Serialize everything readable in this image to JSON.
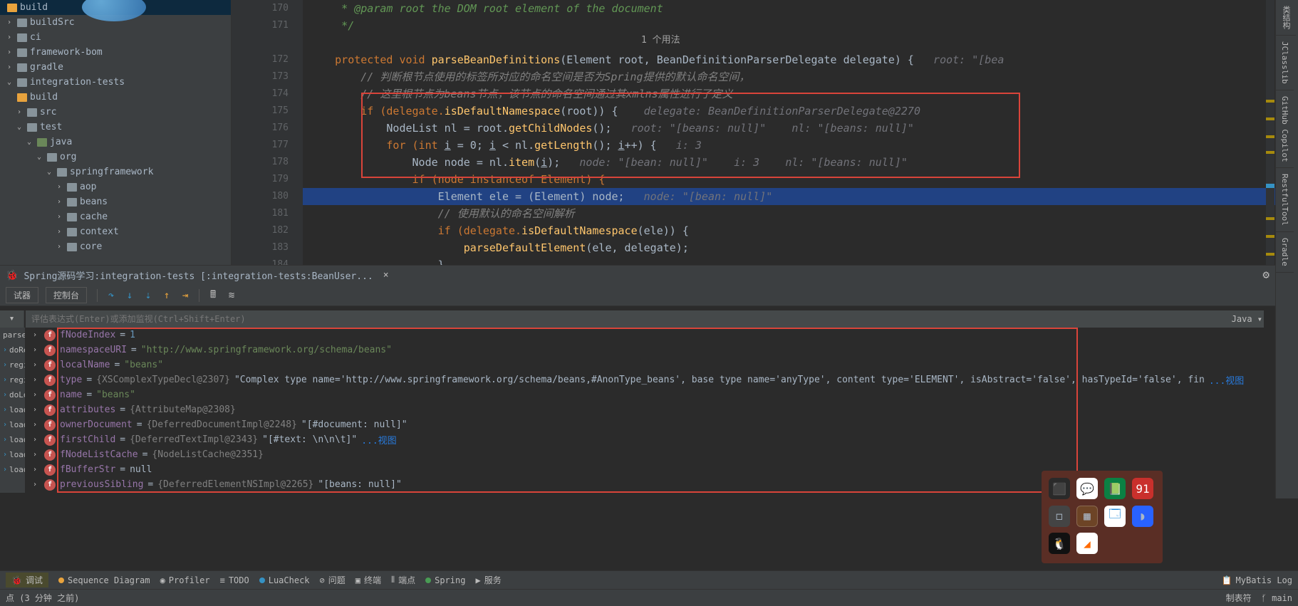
{
  "tree": {
    "items": [
      "build",
      "buildSrc",
      "ci",
      "framework-bom",
      "gradle",
      "integration-tests",
      "build",
      "src",
      "test",
      "java",
      "org",
      "springframework",
      "aop",
      "beans",
      "cache",
      "context",
      "core"
    ]
  },
  "gutter": {
    "lines": [
      "170",
      "171",
      "",
      "172",
      "173",
      "174",
      "175",
      "176",
      "177",
      "178",
      "179",
      "180",
      "181",
      "182",
      "183",
      "184"
    ]
  },
  "usage": "1 个用法",
  "code": {
    "l0": "      * @param root the DOM root element of the document",
    "l1": "      */",
    "l2a": "     protected void ",
    "l2b": "parseBeanDefinitions",
    "l2c": "(Element root, BeanDefinitionParserDelegate delegate) {   ",
    "l2hint": "root: \"[bea",
    "l3": "         // 判断根节点使用的标签所对应的命名空间是否为Spring提供的默认命名空间，",
    "l4": "         // 这里根节点为beans节点，该节点的命名空间通过其xmlns属性进行了定义",
    "l5a": "         if (delegate.",
    "l5b": "isDefaultNamespace",
    "l5c": "(root)) {    ",
    "l5hint": "delegate: BeanDefinitionParserDelegate@2270",
    "l6a": "             NodeList nl = root.",
    "l6b": "getChildNodes",
    "l6c": "();   ",
    "l6hint": "root: \"[beans: null]\"    nl: \"[beans: null]\"",
    "l7a": "             for (int ",
    "l7b": "i",
    "l7c": " = 0; ",
    "l7d": "i",
    "l7e": " < nl.",
    "l7f": "getLength",
    "l7g": "(); ",
    "l7h": "i",
    "l7i": "++) {   ",
    "l7hint": "i: 3",
    "l8a": "                 Node node = nl.",
    "l8b": "item",
    "l8c": "(",
    "l8d": "i",
    "l8e": ");   ",
    "l8hint": "node: \"[bean: null]\"    i: 3    nl: \"[beans: null]\"",
    "l9a": "                 if (node instanceof Element) {",
    "l10a": "                     Element ele = (Element) node;   ",
    "l10hint": "node: \"[bean: null]\"",
    "l11": "                     // 使用默认的命名空间解析",
    "l12a": "                     if (delegate.",
    "l12b": "isDefaultNamespace",
    "l12c": "(ele)) {",
    "l13a": "                         ",
    "l13b": "parseDefaultElement",
    "l13c": "(ele, delegate);",
    "l14": "                     }"
  },
  "dbg": {
    "title": "Spring源码学习:integration-tests [:integration-tests:BeanUser...",
    "tabs": {
      "t1": "试器",
      "t2": "控制台"
    },
    "eval_placeholder": "评估表达式(Enter)或添加监视(Ctrl+Shift+Enter)",
    "lang": "Java",
    "frames": [
      "parse",
      "doRe",
      "regist",
      "regist",
      "doLo",
      "loadB",
      "loadB",
      "loadB",
      "loadB",
      "loadB"
    ]
  },
  "vars": [
    {
      "name": "fNodeIndex",
      "eq": " = ",
      "val": "1",
      "cls": "num"
    },
    {
      "name": "namespaceURI",
      "eq": " = ",
      "val": "\"http://www.springframework.org/schema/beans\"",
      "cls": "str"
    },
    {
      "name": "localName",
      "eq": " = ",
      "val": "\"beans\"",
      "cls": "str"
    },
    {
      "name": "type",
      "eq": " = ",
      "obj": "{XSComplexTypeDecl@2307} ",
      "val": "\"Complex type name='http://www.springframework.org/schema/beans,#AnonType_beans', base type name='anyType', content type='ELEMENT', isAbstract='false', hasTypeId='false', fin",
      "link": "...视图"
    },
    {
      "name": "name",
      "eq": " = ",
      "val": "\"beans\"",
      "cls": "str"
    },
    {
      "name": "attributes",
      "eq": " = ",
      "obj": "{AttributeMap@2308}"
    },
    {
      "name": "ownerDocument",
      "eq": " = ",
      "obj": "{DeferredDocumentImpl@2248} ",
      "val": "\"[#document: null]\""
    },
    {
      "name": "firstChild",
      "eq": " = ",
      "obj": "{DeferredTextImpl@2343} ",
      "val": "\"[#text: \\n\\n\\t]\" ",
      "link": "...视图"
    },
    {
      "name": "fNodeListCache",
      "eq": " = ",
      "obj": "{NodeListCache@2351}"
    },
    {
      "name": "fBufferStr",
      "eq": " = ",
      "val": "null"
    },
    {
      "name": "previousSibling",
      "eq": " = ",
      "obj": "{DeferredElementNSImpl@2265} ",
      "val": "\"[beans: null]\""
    }
  ],
  "bottom": {
    "debug": "调试",
    "seq": "Sequence Diagram",
    "profiler": "Profiler",
    "todo": "TODO",
    "lua": "LuaCheck",
    "problems": "问题",
    "terminal": "终端",
    "endpoints": "端点",
    "spring": "Spring",
    "services": "服务",
    "mybatis": "MyBatis Log"
  },
  "status": {
    "left": "点 (3 分钟 之前)",
    "crlf": "制表符",
    "branch": "main"
  },
  "rtabs": [
    "类结构",
    "JClasslib",
    "GitHub Copilot",
    "RestfulTool",
    "Gradle"
  ]
}
